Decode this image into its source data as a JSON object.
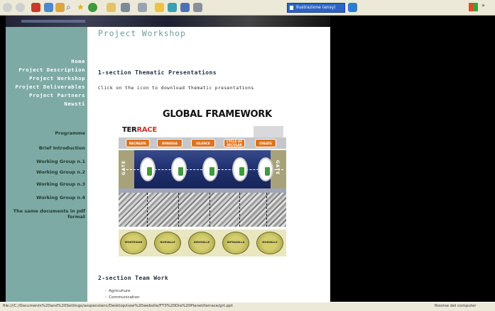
{
  "browser": {
    "toolbar_icons": [
      "back-icon",
      "forward-icon",
      "stop-icon",
      "refresh-icon",
      "home-icon",
      "search-icon",
      "favorites-icon",
      "history-icon",
      "mail-icon",
      "print-icon",
      "edit-icon",
      "messenger-icon"
    ],
    "address_dropdown_text": "Ilustrazione (ensy)",
    "status_url": "file:///C:/Documents%20and%20Settings/asspenslanc/Desktop/new%20website/FT3%20Dia%20Planet/terrace/grt.ppt",
    "status_zone": "Risorse del computer"
  },
  "sidebar": {
    "main_links": [
      "Home",
      "Project Description",
      "Project Workshop",
      "Project Deliverables",
      "Project Partners",
      "Newsti"
    ],
    "sub_links": [
      "Programme",
      "Brief Introduction",
      "Working Group n.1",
      "Working Group n.2",
      "Working Group n.3",
      "Working Group n.4",
      "The same documents in pdf format"
    ]
  },
  "main": {
    "page_title": "Project Workshop",
    "section1": {
      "heading": "1-section Thematic Presentations",
      "subtext": "Click on the icon to download thematic presentations"
    },
    "section2": {
      "heading": "2-section Team Work",
      "items": [
        "Agriculture",
        "Communication"
      ]
    }
  },
  "diagram": {
    "title": "GLOBAL FRAMEWORK",
    "label_part1": "TER",
    "label_part2": "RACE",
    "top_buttons": [
      "RECREATE",
      "WINISSIA",
      "SILENCE",
      "CYCLE OF SECULAR",
      "CREATE"
    ],
    "gate_label": "GATE",
    "bottom_circles": [
      "MONTEGANI",
      "NORVALLE",
      "IDROVALLE",
      "INFRAVALLA",
      "NONVALLE"
    ]
  },
  "colors": {
    "sidebar_bg": "#7eaaa6",
    "title_color": "#6f9e9a",
    "orange_accent": "#e0731f",
    "band_blue": "#223473"
  }
}
